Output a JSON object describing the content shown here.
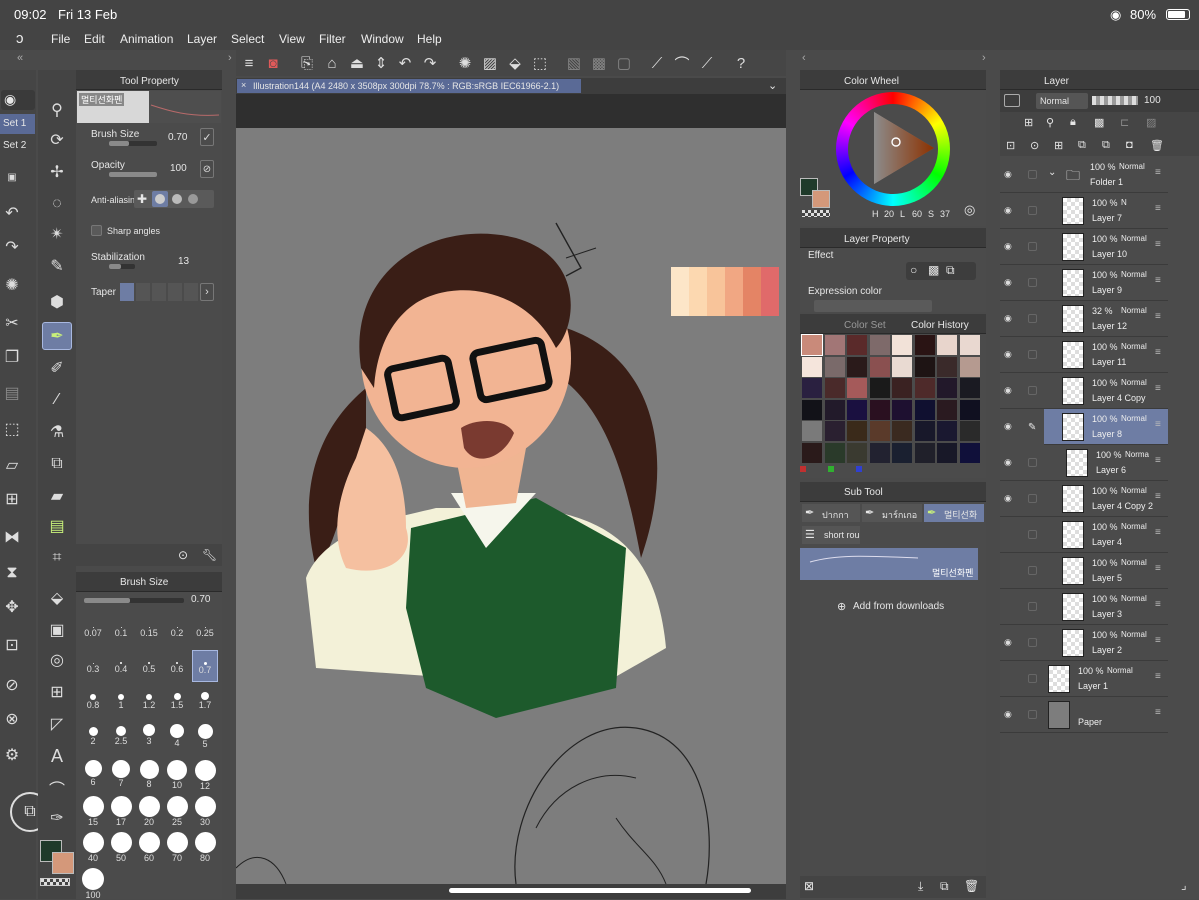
{
  "status": {
    "time": "09:02",
    "date": "Fri 13 Feb",
    "battery": "80%"
  },
  "menu": [
    "File",
    "Edit",
    "Animation",
    "Layer",
    "Select",
    "View",
    "Filter",
    "Window",
    "Help"
  ],
  "sets": [
    "Set 1",
    "Set 2"
  ],
  "tool_property": {
    "title": "Tool Property",
    "brush_name": "멀티선화펜",
    "brush_size_label": "Brush Size",
    "brush_size_value": "0.70",
    "opacity_label": "Opacity",
    "opacity_value": "100",
    "antialias_label": "Anti-aliasing",
    "sharp_angles_label": "Sharp angles",
    "stabilization_label": "Stabilization",
    "stabilization_value": "13",
    "taper_label": "Taper"
  },
  "brush_size_panel": {
    "title": "Brush Size",
    "value": "0.70",
    "sizes": [
      "0.07",
      "0.1",
      "0.15",
      "0.2",
      "0.25",
      "0.3",
      "0.4",
      "0.5",
      "0.6",
      "0.7",
      "0.8",
      "1",
      "1.2",
      "1.5",
      "1.7",
      "2",
      "2.5",
      "3",
      "4",
      "5",
      "6",
      "7",
      "8",
      "10",
      "12",
      "15",
      "17",
      "20",
      "25",
      "30",
      "40",
      "50",
      "60",
      "70",
      "80",
      "100"
    ]
  },
  "canvas": {
    "tab_title": "Illustration144 (A4 2480 x 3508px 300dpi 78.7% : RGB:sRGB IEC61966-2.1)"
  },
  "color_wheel": {
    "title": "Color Wheel",
    "h_label": "H",
    "h": "20",
    "l_label": "L",
    "l": "60",
    "s_label": "S",
    "s": "37"
  },
  "layer_property": {
    "title": "Layer Property",
    "effect_label": "Effect",
    "expression_label": "Expression color"
  },
  "color_set": {
    "tab1": "Color Set",
    "tab2": "Color History"
  },
  "sub_tool": {
    "title": "Sub Tool",
    "tabs": [
      "ปากกา",
      "มาร์กเกอ",
      "멀티선화"
    ],
    "short": "short rou",
    "selected_brush": "멀티선화펜",
    "add_downloads": "Add from downloads"
  },
  "layer_panel": {
    "title": "Layer",
    "blend": "Normal",
    "opacity": "100",
    "layers": [
      {
        "pct": "100 %",
        "mode": "Normal",
        "name": "Folder 1"
      },
      {
        "pct": "100 %",
        "mode": "N",
        "name": "Layer 7"
      },
      {
        "pct": "100 %",
        "mode": "Normal",
        "name": "Layer 10"
      },
      {
        "pct": "100 %",
        "mode": "Normal",
        "name": "Layer 9"
      },
      {
        "pct": "32 %",
        "mode": "Normal",
        "name": "Layer 12"
      },
      {
        "pct": "100 %",
        "mode": "Normal",
        "name": "Layer 11"
      },
      {
        "pct": "100 %",
        "mode": "Normal",
        "name": "Layer 4 Copy"
      },
      {
        "pct": "100 %",
        "mode": "Normal",
        "name": "Layer 8"
      },
      {
        "pct": "100 %",
        "mode": "Norma",
        "name": "Layer 6"
      },
      {
        "pct": "100 %",
        "mode": "Normal",
        "name": "Layer 4 Copy 2"
      },
      {
        "pct": "100 %",
        "mode": "Normal",
        "name": "Layer 4"
      },
      {
        "pct": "100 %",
        "mode": "Normal",
        "name": "Layer 5"
      },
      {
        "pct": "100 %",
        "mode": "Normal",
        "name": "Layer 3"
      },
      {
        "pct": "100 %",
        "mode": "Normal",
        "name": "Layer 2"
      },
      {
        "pct": "100 %",
        "mode": "Normal",
        "name": "Layer 1"
      },
      {
        "pct": "",
        "mode": "",
        "name": "Paper"
      }
    ]
  },
  "colors": {
    "accent": "#6f7fa8",
    "main_color": "#1f3a2a",
    "sub_color": "#d4987a",
    "palette": [
      "#fde6c8",
      "#fcd8b0",
      "#f8c49a",
      "#f1a783",
      "#e48465",
      "#e06a6a"
    ]
  },
  "history_swatches": [
    "#c98a7a",
    "#a27676",
    "#5a2a2a",
    "#7e6a6a",
    "#f2e2d8",
    "#2a1414",
    "#e8d5cc",
    "#e9d8d0",
    "#f5e5dc",
    "#7a6a6a",
    "#2a1a1a",
    "#8a5050",
    "#e9dad2",
    "#1e1414",
    "#3a2a2a",
    "#b59a90",
    "#2a2040",
    "#4a2a2a",
    "#a55a5a",
    "#1a1a1a",
    "#3a2222",
    "#4e2a2a",
    "#22182a",
    "#1a1a22",
    "#121218",
    "#221a2a",
    "#1a1040",
    "#2a1020",
    "#1e1030",
    "#101030",
    "#2a1a20",
    "#101020",
    "#7a7a7a",
    "#2a2030",
    "#3a2a1a",
    "#5a3a2a",
    "#3a2a20",
    "#18182a",
    "#1a1830",
    "#2a2a2a",
    "#2a1a1a",
    "#2a3a2a",
    "#3a3a30",
    "#222230",
    "#1a2030",
    "#20202a",
    "#181828",
    "#10103a"
  ]
}
